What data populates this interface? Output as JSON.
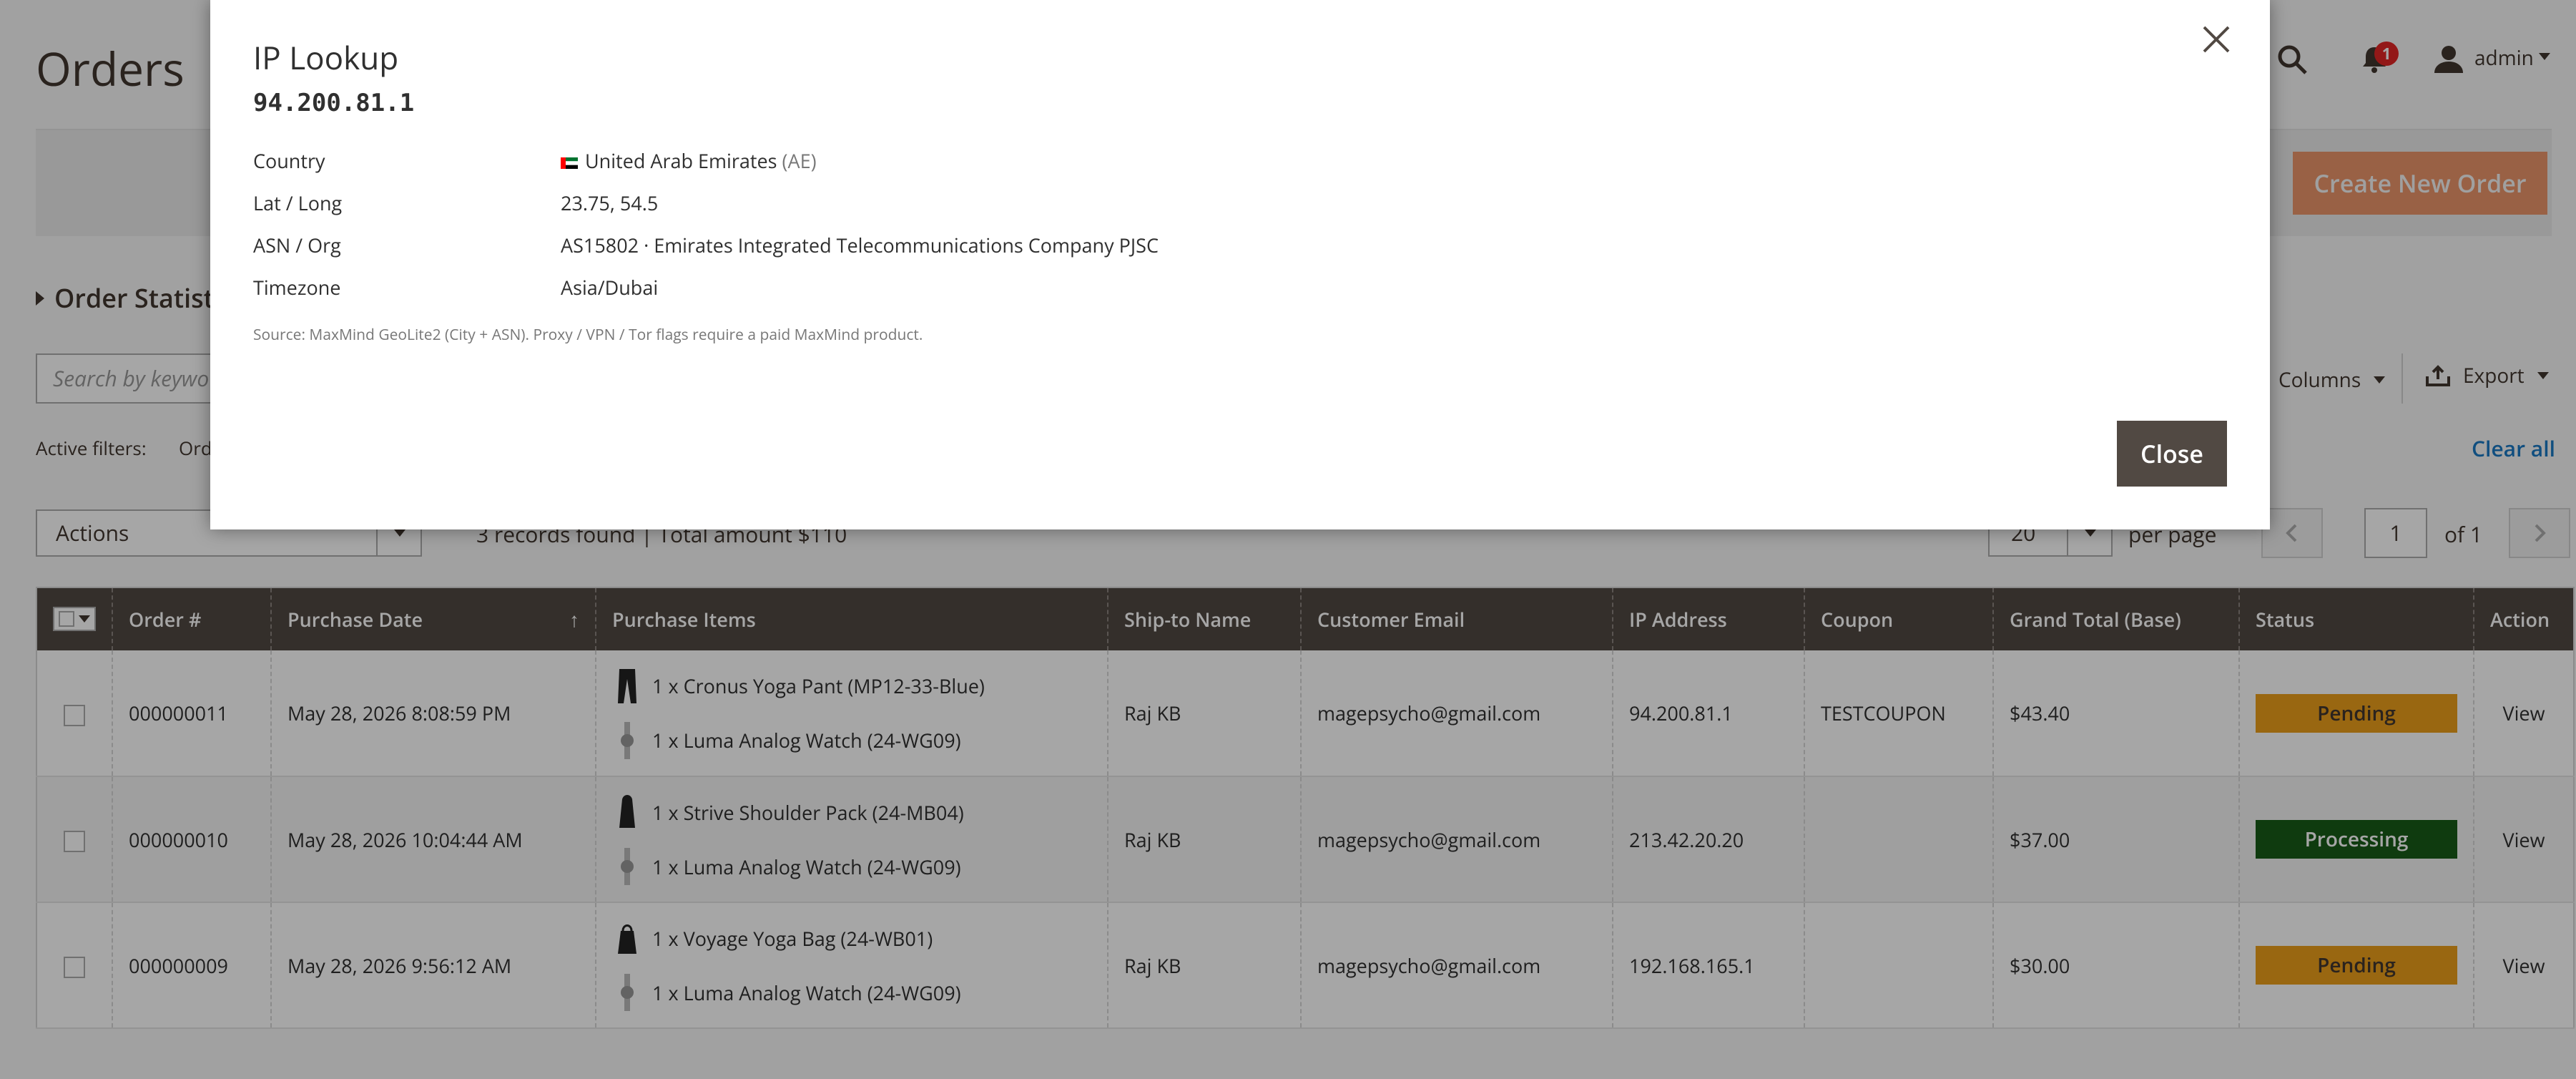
{
  "page": {
    "title": "Orders"
  },
  "header": {
    "notifications_count": "1",
    "user_name": "admin"
  },
  "action_bar": {
    "create_button_label": "Create New Order"
  },
  "order_statistics": {
    "label": "Order Statisti"
  },
  "toolbar": {
    "search_placeholder": "Search by keywo",
    "columns_label": "Columns",
    "export_label": "Export",
    "active_filters_label": "Active filters:",
    "active_filter_chip": "Ord",
    "clear_all_label": "Clear all",
    "actions_select": "Actions",
    "records_summary": "3 records found | Total amount $110",
    "per_page_value": "20",
    "per_page_label": "per page",
    "page_input": "1",
    "page_of": "of 1"
  },
  "grid": {
    "columns": [
      "Order #",
      "Purchase Date",
      "Purchase Items",
      "Ship-to Name",
      "Customer Email",
      "IP Address",
      "Coupon",
      "Grand Total (Base)",
      "Status",
      "Action"
    ],
    "rows": [
      {
        "order_no": "000000011",
        "date": "May 28, 2026 8:08:59 PM",
        "items": [
          "1 x Cronus Yoga Pant (MP12-33-Blue)",
          "1 x Luma Analog Watch (24-WG09)"
        ],
        "ship_to": "Raj KB",
        "email": "magepsycho@gmail.com",
        "ip": "94.200.81.1",
        "coupon": "TESTCOUPON",
        "total": "$43.40",
        "status": "Pending",
        "action": "View"
      },
      {
        "order_no": "000000010",
        "date": "May 28, 2026 10:04:44 AM",
        "items": [
          "1 x Strive Shoulder Pack (24-MB04)",
          "1 x Luma Analog Watch (24-WG09)"
        ],
        "ship_to": "Raj KB",
        "email": "magepsycho@gmail.com",
        "ip": "213.42.20.20",
        "coupon": "",
        "total": "$37.00",
        "status": "Processing",
        "action": "View"
      },
      {
        "order_no": "000000009",
        "date": "May 28, 2026 9:56:12 AM",
        "items": [
          "1 x Voyage Yoga Bag (24-WB01)",
          "1 x Luma Analog Watch (24-WG09)"
        ],
        "ship_to": "Raj KB",
        "email": "magepsycho@gmail.com",
        "ip": "192.168.165.1",
        "coupon": "",
        "total": "$30.00",
        "status": "Pending",
        "action": "View"
      }
    ]
  },
  "modal": {
    "title": "IP Lookup",
    "ip": "94.200.81.1",
    "fields": [
      {
        "label": "Country",
        "value": "United Arab Emirates",
        "suffix": "(AE)"
      },
      {
        "label": "Lat / Long",
        "value": "23.75, 54.5"
      },
      {
        "label": "ASN / Org",
        "value": "AS15802 · Emirates Integrated Telecommunications Company PJSC"
      },
      {
        "label": "Timezone",
        "value": "Asia/Dubai"
      }
    ],
    "source_note": "Source: MaxMind GeoLite2 (City + ASN). Proxy / VPN / Tor flags require a paid MaxMind product.",
    "close_button_label": "Close"
  },
  "colors": {
    "accent_orange": "#eb5202",
    "header_dark": "#514943",
    "link_blue": "#1979c3",
    "pending": "#eb9e1b",
    "processing": "#185b18"
  }
}
